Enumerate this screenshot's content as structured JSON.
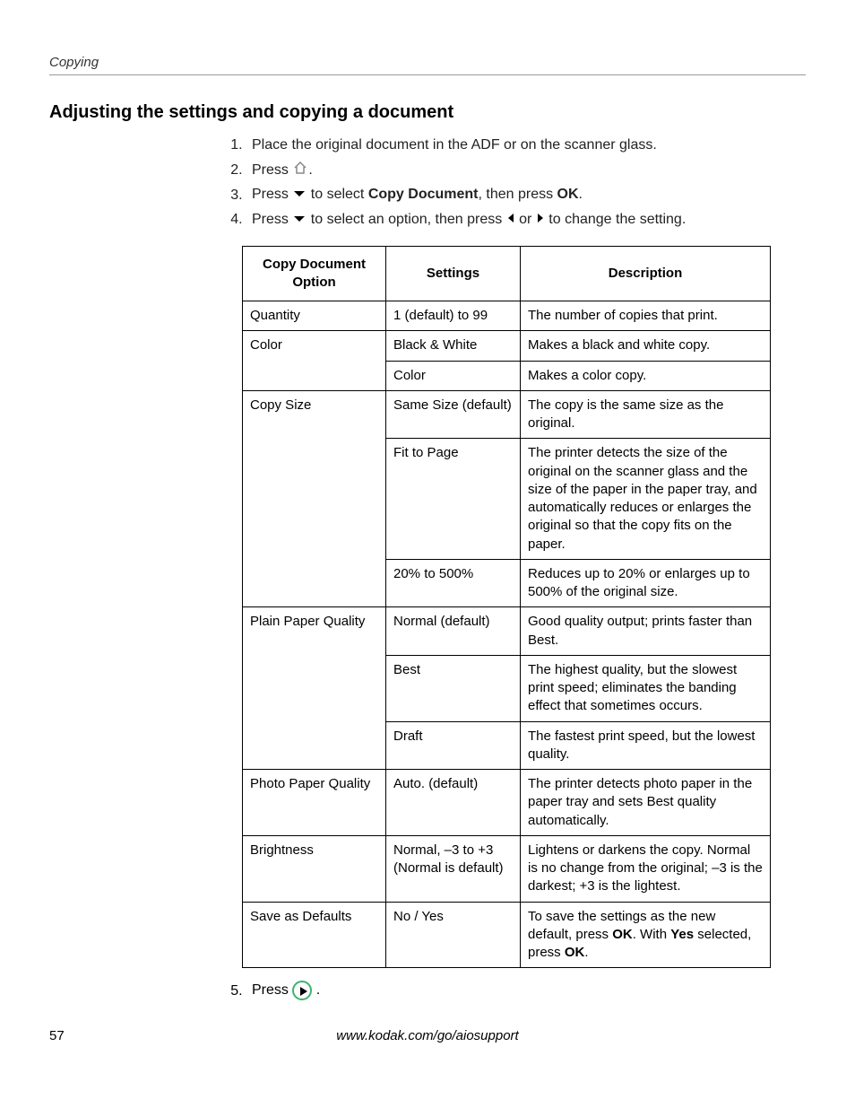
{
  "header": {
    "section": "Copying"
  },
  "title": "Adjusting the settings and copying a document",
  "steps": {
    "s1": "Place the original document in the ADF or on the scanner glass.",
    "s2a": "Press ",
    "s2b": ".",
    "s3a": "Press ",
    "s3b": " to select ",
    "s3c": "Copy Document",
    "s3d": ", then press ",
    "s3e": "OK",
    "s3f": ".",
    "s4a": "Press ",
    "s4b": " to select an option, then press ",
    "s4c": " or ",
    "s4d": " to change the setting.",
    "s5a": "Press ",
    "s5b": " ."
  },
  "table": {
    "headers": {
      "h1": "Copy Document Option",
      "h2": "Settings",
      "h3": "Description"
    },
    "rows": [
      {
        "opt": "Quantity",
        "setting": "1 (default) to 99",
        "desc": "The number of copies that print."
      },
      {
        "opt": "Color",
        "setting": "Black & White",
        "desc": "Makes a black and white copy."
      },
      {
        "opt": "",
        "setting": "Color",
        "desc": "Makes a color copy."
      },
      {
        "opt": "Copy Size",
        "setting": "Same Size (default)",
        "desc": "The copy is the same size as the original."
      },
      {
        "opt": "",
        "setting": "Fit to Page",
        "desc": "The printer detects the size of the original on the scanner glass and the size of the paper in the paper tray, and automatically reduces or enlarges the original so that the copy fits on the paper."
      },
      {
        "opt": "",
        "setting": "20% to 500%",
        "desc": "Reduces up to 20% or enlarges up to 500% of the original size."
      },
      {
        "opt": "Plain Paper Quality",
        "setting": "Normal (default)",
        "desc": "Good quality output; prints faster than Best."
      },
      {
        "opt": "",
        "setting": "Best",
        "desc": "The highest quality, but the slowest print speed; eliminates the banding effect that sometimes occurs."
      },
      {
        "opt": "",
        "setting": "Draft",
        "desc": "The fastest print speed, but the lowest quality."
      },
      {
        "opt": "Photo Paper Quality",
        "setting": "Auto. (default)",
        "desc": "The printer detects photo paper in the paper tray and sets Best quality automatically."
      },
      {
        "opt": "Brightness",
        "setting": "Normal, –3 to +3 (Normal is default)",
        "desc": "Lightens or darkens the copy. Normal is no change from the original; –3 is the darkest; +3 is the lightest."
      },
      {
        "opt": "Save as Defaults",
        "setting": "No / Yes",
        "desc_a": "To save the settings as the new default, press ",
        "desc_b": "OK",
        "desc_c": ". With ",
        "desc_d": "Yes",
        "desc_e": " selected, press ",
        "desc_f": "OK",
        "desc_g": "."
      }
    ]
  },
  "footer": {
    "page": "57",
    "url": "www.kodak.com/go/aiosupport"
  }
}
